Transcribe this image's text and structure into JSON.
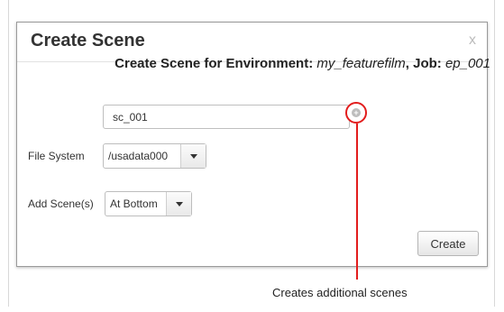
{
  "dialog": {
    "title": "Create Scene",
    "close_label": "x",
    "subtitle": {
      "prefix": "Create Scene for Environment:",
      "environment": "my_featurefilm",
      "job_label": ", Job:",
      "job": "ep_001"
    },
    "scene_name": {
      "value": "sc_001",
      "add_button_icon": "plus-circle-icon"
    },
    "file_system": {
      "label": "File System",
      "selected": "/usadata000"
    },
    "add_scenes": {
      "label": "Add Scene(s)",
      "selected": "At Bottom"
    },
    "create_label": "Create"
  },
  "callout": {
    "text": "Creates additional scenes",
    "color": "#e21d1d"
  }
}
